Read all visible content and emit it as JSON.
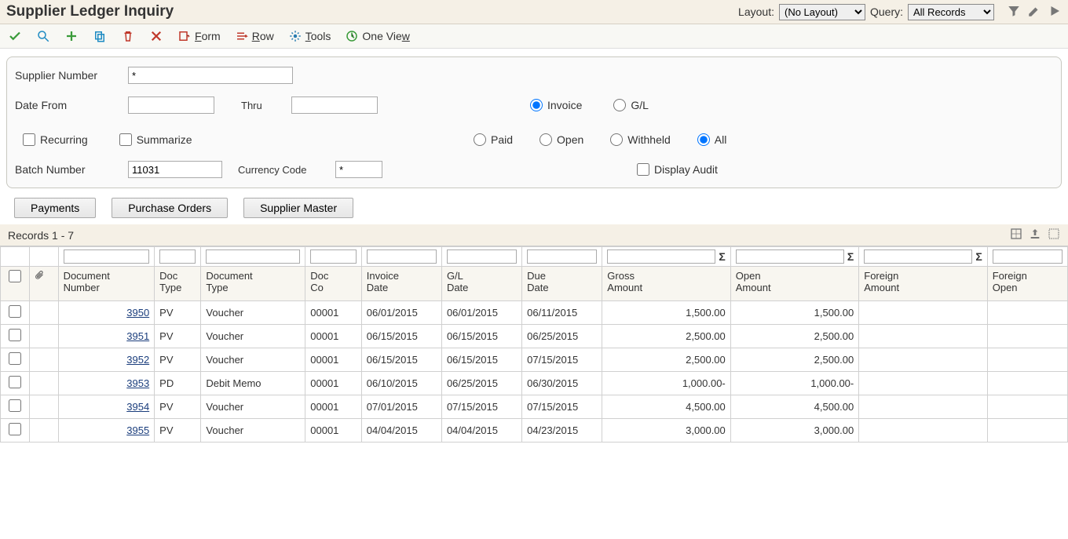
{
  "header": {
    "title": "Supplier Ledger Inquiry",
    "layout_label": "Layout:",
    "layout_value": "(No Layout)",
    "query_label": "Query:",
    "query_value": "All Records"
  },
  "toolbar": {
    "form": "Form",
    "row": "Row",
    "tools": "Tools",
    "oneview": "One View"
  },
  "form": {
    "supplier_number_label": "Supplier Number",
    "supplier_number_value": "*",
    "date_from_label": "Date From",
    "thru_label": "Thru",
    "invoice_label": "Invoice",
    "gl_label": "G/L",
    "recurring_label": "Recurring",
    "summarize_label": "Summarize",
    "paid_label": "Paid",
    "open_label": "Open",
    "withheld_label": "Withheld",
    "all_label": "All",
    "batch_number_label": "Batch Number",
    "batch_number_value": "11031",
    "currency_code_label": "Currency Code",
    "currency_code_value": "*",
    "display_audit_label": "Display Audit"
  },
  "buttons": {
    "payments": "Payments",
    "purchase_orders": "Purchase Orders",
    "supplier_master": "Supplier Master"
  },
  "records_label": "Records 1 - 7",
  "columns": {
    "doc_number": "Document\nNumber",
    "doc_typ": "Doc\nType",
    "doc_type": "Document\nType",
    "doc_co": "Doc\nCo",
    "invoice_date": "Invoice\nDate",
    "gl_date": "G/L\nDate",
    "due_date": "Due\nDate",
    "gross": "Gross\nAmount",
    "open_amt": "Open\nAmount",
    "foreign": "Foreign\nAmount",
    "foreign_open": "Foreign\nOpen"
  },
  "rows": [
    {
      "doc_number": "3950",
      "doc_typ": "PV",
      "doc_type": "Voucher",
      "doc_co": "00001",
      "invoice_date": "06/01/2015",
      "gl_date": "06/01/2015",
      "due_date": "06/11/2015",
      "gross": "1,500.00",
      "open_amt": "1,500.00",
      "foreign": "",
      "foreign_open": ""
    },
    {
      "doc_number": "3951",
      "doc_typ": "PV",
      "doc_type": "Voucher",
      "doc_co": "00001",
      "invoice_date": "06/15/2015",
      "gl_date": "06/15/2015",
      "due_date": "06/25/2015",
      "gross": "2,500.00",
      "open_amt": "2,500.00",
      "foreign": "",
      "foreign_open": ""
    },
    {
      "doc_number": "3952",
      "doc_typ": "PV",
      "doc_type": "Voucher",
      "doc_co": "00001",
      "invoice_date": "06/15/2015",
      "gl_date": "06/15/2015",
      "due_date": "07/15/2015",
      "gross": "2,500.00",
      "open_amt": "2,500.00",
      "foreign": "",
      "foreign_open": ""
    },
    {
      "doc_number": "3953",
      "doc_typ": "PD",
      "doc_type": "Debit Memo",
      "doc_co": "00001",
      "invoice_date": "06/10/2015",
      "gl_date": "06/25/2015",
      "due_date": "06/30/2015",
      "gross": "1,000.00-",
      "open_amt": "1,000.00-",
      "foreign": "",
      "foreign_open": ""
    },
    {
      "doc_number": "3954",
      "doc_typ": "PV",
      "doc_type": "Voucher",
      "doc_co": "00001",
      "invoice_date": "07/01/2015",
      "gl_date": "07/15/2015",
      "due_date": "07/15/2015",
      "gross": "4,500.00",
      "open_amt": "4,500.00",
      "foreign": "",
      "foreign_open": ""
    },
    {
      "doc_number": "3955",
      "doc_typ": "PV",
      "doc_type": "Voucher",
      "doc_co": "00001",
      "invoice_date": "04/04/2015",
      "gl_date": "04/04/2015",
      "due_date": "04/23/2015",
      "gross": "3,000.00",
      "open_amt": "3,000.00",
      "foreign": "",
      "foreign_open": ""
    }
  ]
}
